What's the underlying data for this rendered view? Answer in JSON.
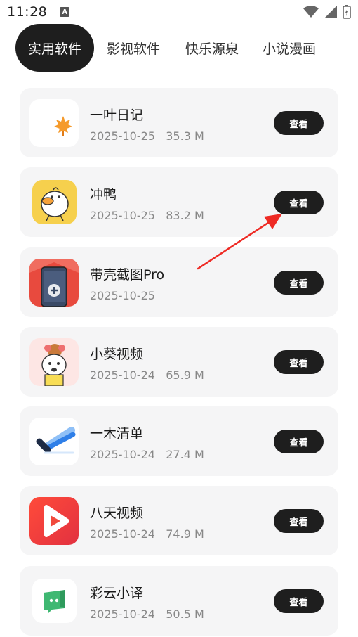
{
  "status_bar": {
    "time": "11:28",
    "notification_letter": "A"
  },
  "tabs": [
    {
      "label": "实用软件",
      "active": true
    },
    {
      "label": "影视软件",
      "active": false
    },
    {
      "label": "快乐源泉",
      "active": false
    },
    {
      "label": "小说漫画",
      "active": false
    }
  ],
  "apps": [
    {
      "name": "一叶日记",
      "meta": "2025-10-25   35.3 M",
      "button": "查看",
      "icon": "maple-leaf-icon"
    },
    {
      "name": "冲鸭",
      "meta": "2025-10-25   83.2 M",
      "button": "查看",
      "icon": "duck-icon"
    },
    {
      "name": "带壳截图Pro",
      "meta": "2025-10-25",
      "button": "查看",
      "icon": "phone-screenshot-icon"
    },
    {
      "name": "小葵视频",
      "meta": "2025-10-24   65.9 M",
      "button": "查看",
      "icon": "cartoon-girl-icon"
    },
    {
      "name": "一木清单",
      "meta": "2025-10-24   27.4 M",
      "button": "查看",
      "icon": "checkmark-icon"
    },
    {
      "name": "八天视频",
      "meta": "2025-10-24   74.9 M",
      "button": "查看",
      "icon": "play-icon"
    },
    {
      "name": "彩云小译",
      "meta": "2025-10-24   50.5 M",
      "button": "查看",
      "icon": "chat-bubble-icon"
    }
  ],
  "colors": {
    "accent": "#1e1e1e",
    "card_bg": "#f5f5f6",
    "annotation_arrow": "#ee2a24"
  }
}
